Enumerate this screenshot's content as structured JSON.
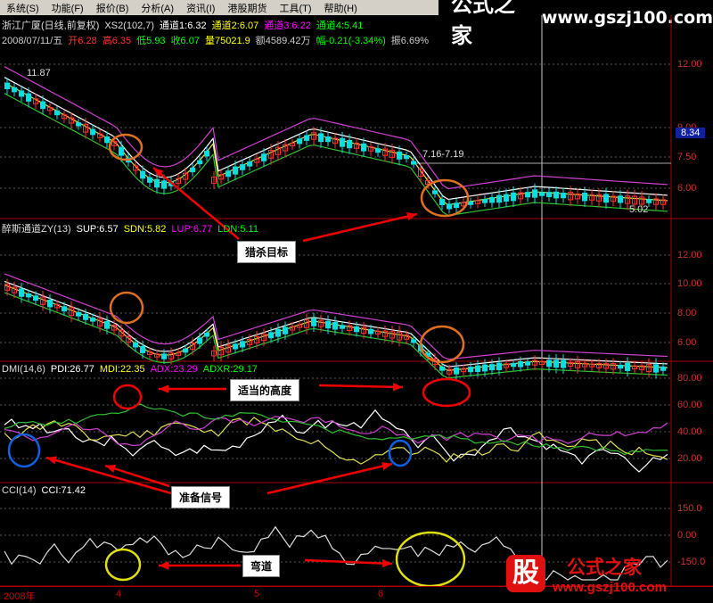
{
  "menu": [
    "系统(S)",
    "功能(F)",
    "报价(B)",
    "分析(A)",
    "资讯(I)",
    "港股期货",
    "工具(T)",
    "帮助(H)"
  ],
  "brand": {
    "name": "公式之家",
    "url": "www.gszj100.com"
  },
  "brand2": {
    "glyph": "股",
    "name": "公式之家",
    "url": "www.gszj100.com"
  },
  "main": {
    "title": "浙江广厦(日线,前复权)",
    "indicator": "XS2(102,7)",
    "ch1": "通道1:6.32",
    "ch2": "通道2:6.07",
    "ch3": "通道3:6.22",
    "ch4": "通道4:5.41",
    "quote": {
      "date": "2008/07/11/五",
      "open": "开6.28",
      "high": "高6.35",
      "low": "低5.93",
      "close": "收6.07",
      "vol": "量75021.9",
      "amt": "额4589.42万",
      "chg": "幅-0.21(-3.34%)",
      "amp": "振6.69%"
    },
    "high_mark": "11.87",
    "range_mark": "7.16-7.19",
    "low_mark": "5.02",
    "price_tag": "8.34",
    "yticks": [
      "12.00",
      "9.00",
      "7.50",
      "6.00"
    ]
  },
  "pane2": {
    "title": "醉斯通道ZY(13)",
    "sup": "SUP:6.57",
    "sdn": "SDN:5.82",
    "lup": "LUP:6.77",
    "ldn": "LDN:5.11",
    "yticks": [
      "12.00",
      "10.00",
      "8.00",
      "6.00"
    ]
  },
  "dmi": {
    "title": "DMI(14,6)",
    "pdi": "PDI:26.77",
    "mdi": "MDI:22.35",
    "adx": "ADX:23.29",
    "adxr": "ADXR:29.17",
    "yticks": [
      "80.00",
      "60.00",
      "40.00",
      "20.00"
    ]
  },
  "cci": {
    "title": "CCI(14)",
    "value": "CCI:71.42",
    "yticks": [
      "150.0",
      "0.00",
      "-150.0"
    ]
  },
  "annotations": {
    "kill": "猎杀目标",
    "height": "适当的高度",
    "prep": "准备信号",
    "curve": "弯道"
  },
  "xaxis": [
    "2008年",
    "4",
    "5",
    "6"
  ],
  "colors": {
    "up": "#ff3030",
    "down": "#00e0e0",
    "purple": "#d040d0",
    "green": "#30c030",
    "yellow": "#e0e050",
    "white": "#ffffff"
  }
}
